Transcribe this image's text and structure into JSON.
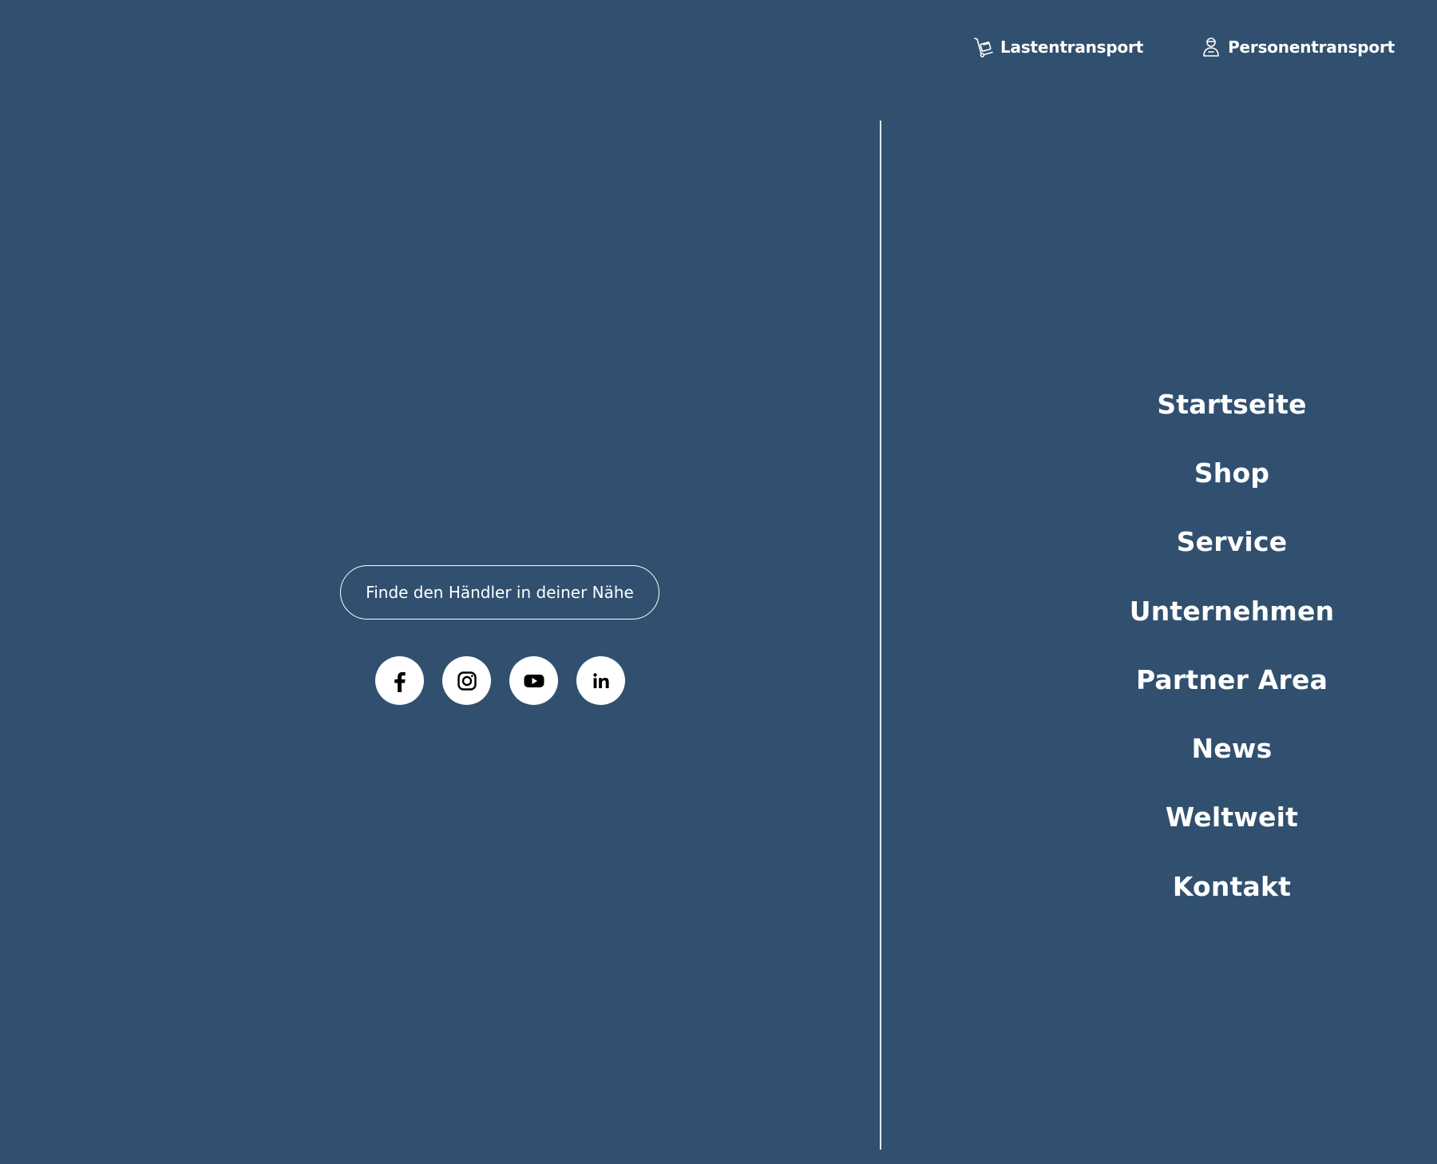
{
  "topbar": {
    "links": [
      {
        "label": "Lastentransport",
        "icon": "cargo-hand-truck-icon"
      },
      {
        "label": "Personentransport",
        "icon": "person-icon"
      }
    ]
  },
  "dealer_button": {
    "label": "Finde den Händler in deiner Nähe"
  },
  "socials": [
    {
      "icon": "facebook-icon"
    },
    {
      "icon": "instagram-icon"
    },
    {
      "icon": "youtube-icon"
    },
    {
      "icon": "linkedin-icon"
    }
  ],
  "main_nav": {
    "items": [
      {
        "label": "Startseite"
      },
      {
        "label": "Shop"
      },
      {
        "label": "Service"
      },
      {
        "label": "Unternehmen"
      },
      {
        "label": "Partner Area"
      },
      {
        "label": "News"
      },
      {
        "label": "Weltweit"
      },
      {
        "label": "Kontakt"
      }
    ]
  },
  "colors": {
    "background": "#31506f",
    "text": "#ffffff",
    "divider": "#dfe6ee",
    "icon_dark": "#000000"
  }
}
